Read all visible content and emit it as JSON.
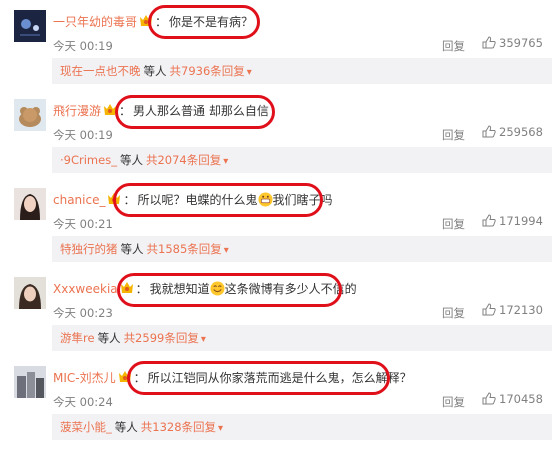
{
  "comments": [
    {
      "user": "一只年幼的毒哥",
      "colon": "：",
      "text_parts": [
        "你是不是有病？"
      ],
      "emoji": [],
      "time": "今天 00:19",
      "reply": "回复",
      "likes": "359765",
      "sub_first": "现在一点也不晚",
      "sub_etc": "等人",
      "sub_total": "共7936条回复"
    },
    {
      "user": "飛行漫游",
      "colon": "：",
      "text_parts": [
        "男人那么普通 却那么自信"
      ],
      "emoji": [],
      "time": "今天 00:19",
      "reply": "回复",
      "likes": "259568",
      "sub_first": "·9Crimes_",
      "sub_etc": "等人",
      "sub_total": "共2074条回复"
    },
    {
      "user": "chanice_",
      "colon": "：",
      "text_parts": [
        "所以呢？电蝶的什么鬼",
        "我们瞎子吗"
      ],
      "emoji": [
        "grin-emoji"
      ],
      "time": "今天 00:21",
      "reply": "回复",
      "likes": "171994",
      "sub_first": "特独行的猪",
      "sub_etc": "等人",
      "sub_total": "共1585条回复"
    },
    {
      "user": "Xxxweekia",
      "colon": "：",
      "text_parts": [
        "我就想知道",
        "这条微博有多少人不信的"
      ],
      "emoji": [
        "happy-emoji"
      ],
      "time": "今天 00:23",
      "reply": "回复",
      "likes": "172130",
      "sub_first": "游隼re",
      "sub_etc": "等人",
      "sub_total": "共2599条回复"
    },
    {
      "user": "MIC-刘杰儿",
      "colon": "：",
      "text_parts": [
        "所以江铠同从你家落荒而逃是什么鬼，怎么解释？"
      ],
      "emoji": [],
      "time": "今天 00:24",
      "reply": "回复",
      "likes": "170458",
      "sub_first": "菠菜小能_",
      "sub_etc": "等人",
      "sub_total": "共1328条回复"
    }
  ],
  "sub_arrow": "▾",
  "colors": {
    "username": "#eb7350",
    "highlight_ring": "#e0101b",
    "meta": "#808080",
    "subbox": "#f2f2f5"
  }
}
